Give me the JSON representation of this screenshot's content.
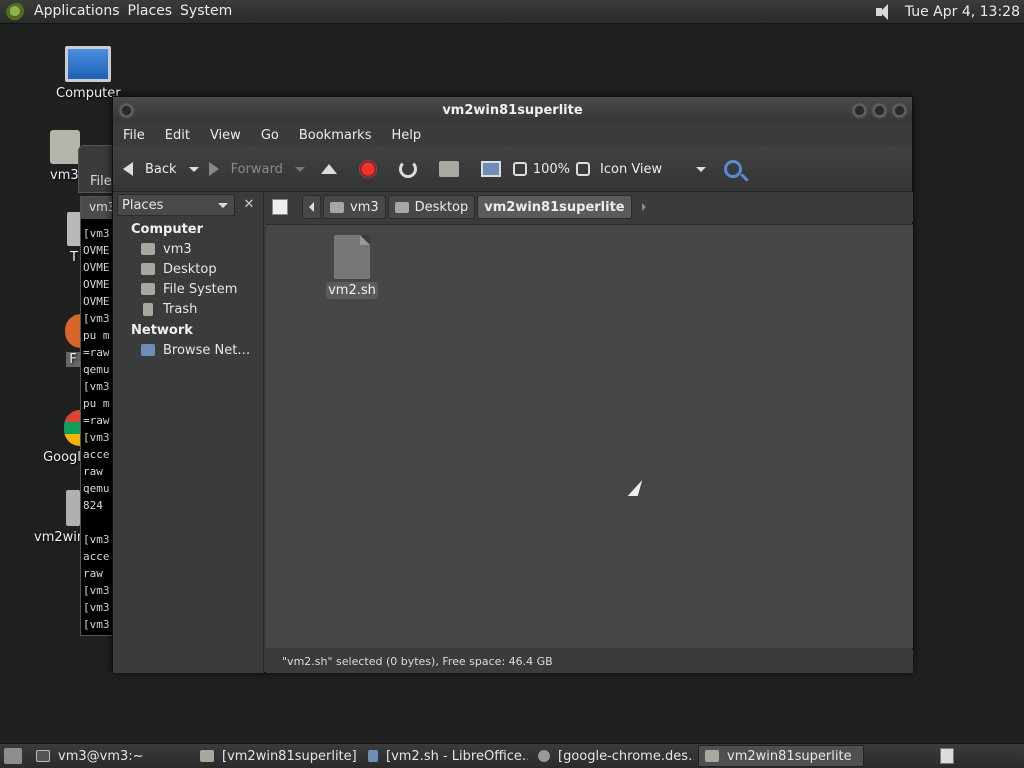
{
  "top_panel": {
    "menus": [
      "Applications",
      "Places",
      "System"
    ],
    "clock": "Tue Apr  4, 13:28"
  },
  "desktop": {
    "icons": [
      {
        "label": "Computer"
      },
      {
        "label": "vm3'"
      },
      {
        "label": "T"
      },
      {
        "label": "F"
      },
      {
        "label": "Googl"
      },
      {
        "label": "vm2win"
      }
    ],
    "background_window_title": "File",
    "terminal_tab": "vm3",
    "terminal_lines": [
      "[vm3",
      "OVME",
      "OVME",
      "OVME",
      "OVME",
      "[vm3",
      "pu m",
      "=raw",
      "qemu",
      "[vm3",
      "pu m",
      "=raw",
      "[vm3",
      "acce",
      "raw ",
      "qemu",
      "824 ",
      "",
      "[vm3",
      "acce",
      "raw ",
      "[vm3",
      "[vm3",
      "[vm3"
    ]
  },
  "window": {
    "title": "vm2win81superlite",
    "menu": [
      "File",
      "Edit",
      "View",
      "Go",
      "Bookmarks",
      "Help"
    ],
    "toolbar": {
      "back": "Back",
      "forward": "Forward",
      "zoom": "100%",
      "view_mode": "Icon View"
    },
    "sidebar": {
      "header": "Places",
      "close": "✕",
      "groups": [
        {
          "title": "Computer",
          "items": [
            "vm3",
            "Desktop",
            "File System",
            "Trash"
          ]
        },
        {
          "title": "Network",
          "items": [
            "Browse Net…"
          ]
        }
      ]
    },
    "pathbar": [
      "vm3",
      "Desktop",
      "vm2win81superlite"
    ],
    "files": [
      {
        "name": "vm2.sh"
      }
    ],
    "status": "\"vm2.sh\" selected (0 bytes), Free space: 46.4 GB"
  },
  "taskbar": {
    "tasks": [
      "vm3@vm3:~",
      "[vm2win81superlite]",
      "[vm2.sh - LibreOffice…",
      "[google-chrome.des…",
      "vm2win81superlite"
    ]
  }
}
